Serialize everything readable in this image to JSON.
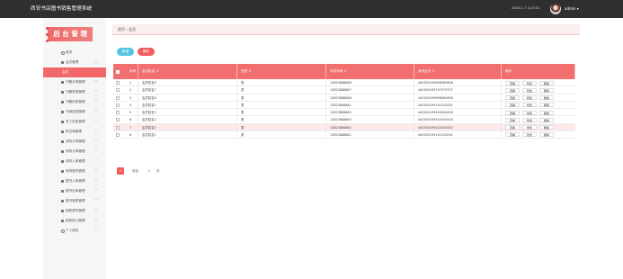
{
  "header": {
    "title": "西安书店图书销售管理系统",
    "datetime": "2024-1-7 12:3:41",
    "user": "admin ▾"
  },
  "sidebar": {
    "logo": "后 台 管 理",
    "items": [
      {
        "label": "首页",
        "icon": "circle-icon"
      },
      {
        "label": "会员管理",
        "icon": "grid-icon",
        "chevron": "︿"
      },
      {
        "label": "会员",
        "active": true
      },
      {
        "label": "书籍分类管理",
        "icon": "grid-icon",
        "chevron": "﹀"
      },
      {
        "label": "书籍类型管理",
        "icon": "gear-icon",
        "chevron": "﹀"
      },
      {
        "label": "书籍信息管理",
        "icon": "grid-icon",
        "chevron": "﹀"
      },
      {
        "label": "书城信息管理",
        "icon": "grid-icon",
        "chevron": "﹀"
      },
      {
        "label": "员工信息管理",
        "icon": "user-icon",
        "chevron": "﹀"
      },
      {
        "label": "供应商管理",
        "icon": "grid-icon",
        "chevron": "﹀"
      },
      {
        "label": "采购订单管理",
        "icon": "grid-icon",
        "chevron": "﹀"
      },
      {
        "label": "采购订单管理",
        "icon": "grid-icon",
        "chevron": "﹀"
      },
      {
        "label": "采购入库管理",
        "icon": "grid-icon",
        "chevron": "﹀"
      },
      {
        "label": "采购退货管理",
        "icon": "grid-icon",
        "chevron": "﹀"
      },
      {
        "label": "图书入库管理",
        "icon": "grid-icon",
        "chevron": "﹀"
      },
      {
        "label": "图书出库管理",
        "icon": "grid-icon",
        "chevron": "﹀"
      },
      {
        "label": "图书销售管理",
        "icon": "grid-icon",
        "chevron": "﹀"
      },
      {
        "label": "销售退货管理",
        "icon": "grid-icon",
        "chevron": "﹀"
      },
      {
        "label": "销售统计管理",
        "icon": "grid-icon",
        "chevron": "﹀"
      },
      {
        "label": "个人资料",
        "icon": "circle-icon",
        "chevron": "﹀"
      }
    ]
  },
  "breadcrumb": "首页 › 会员",
  "toolbar": {
    "add_label": "新增",
    "delete_label": "删除"
  },
  "table": {
    "headers": [
      "序号",
      "会员姓名 ↕",
      "性别 ↕",
      "手机号码 ↕",
      "身份证号 ↕",
      "操作"
    ],
    "action_labels": [
      "查看",
      "修改",
      "删除"
    ],
    "rows": [
      [
        "1",
        "会员姓名8",
        "男",
        "13823888888",
        "440300199808080808"
      ],
      [
        "2",
        "会员姓名7",
        "男",
        "13823888887",
        "440300199707070707"
      ],
      [
        "3",
        "会员姓名6",
        "男",
        "13823888886",
        "440300199606060606"
      ],
      [
        "4",
        "会员姓名1",
        "男",
        "13823888881",
        "440300199101010001"
      ],
      [
        "5",
        "会员姓名3",
        "男",
        "13823888883",
        "440300199404040404"
      ],
      [
        "6",
        "会员姓名2",
        "男",
        "13823888883",
        "440300199303030003"
      ],
      [
        "7",
        "会员姓名2",
        "男",
        "13823888882",
        "440300199202020002"
      ],
      [
        "8",
        "会员姓名1",
        "男",
        "13823888881",
        "440300199101010001"
      ]
    ]
  },
  "pager": {
    "current": "1",
    "text": "前往",
    "page": "1",
    "unit": "页"
  },
  "colors": {
    "accent": "#f26f6f",
    "topbar": "#2f2f2f",
    "add": "#56c3e3"
  }
}
